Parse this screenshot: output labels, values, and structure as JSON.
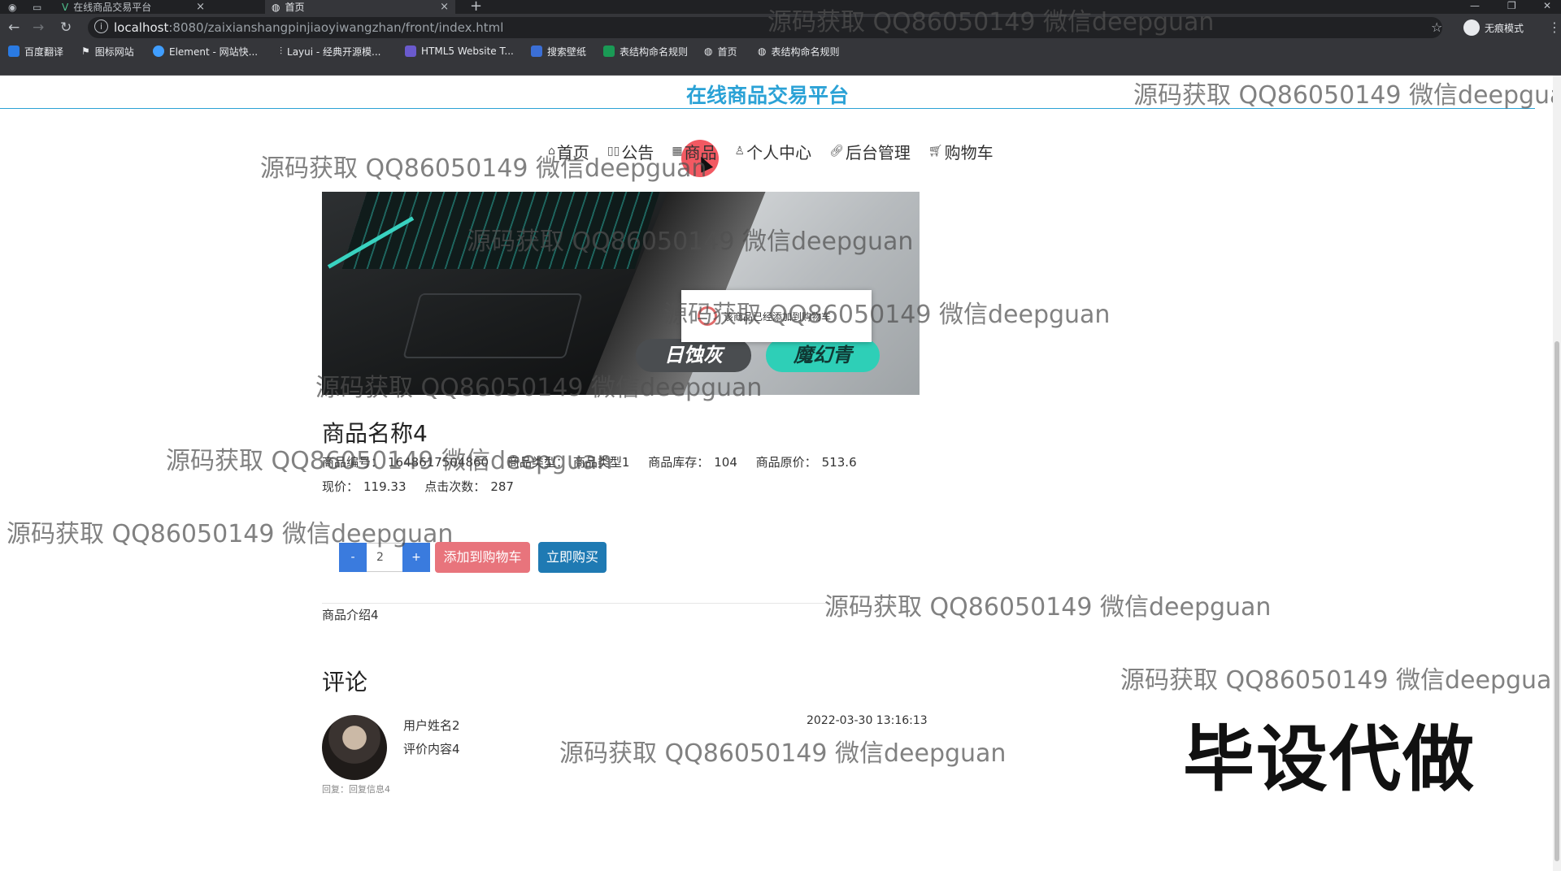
{
  "browser": {
    "tabs": [
      {
        "title": "在线商品交易平台",
        "active": false
      },
      {
        "title": "首页",
        "active": true
      }
    ],
    "new_tab": "+",
    "url_host": "localhost",
    "url_path": ":8080/zaixianshangpinjiaoyiwangzhan/front/index.html",
    "incognito_label": "无痕模式",
    "bookmarks": [
      "百度翻译",
      "图标网站",
      "Element - 网站快...",
      "Layui - 经典开源模...",
      "HTML5 Website T...",
      "搜索壁纸",
      "表结构命名规则",
      "首页",
      "表结构命名规则"
    ]
  },
  "site": {
    "title": "在线商品交易平台",
    "nav": [
      {
        "label": "首页",
        "icon": "home-icon"
      },
      {
        "label": "公告",
        "icon": "announcement-icon"
      },
      {
        "label": "商品",
        "icon": "goods-icon"
      },
      {
        "label": "个人中心",
        "icon": "user-icon"
      },
      {
        "label": "后台管理",
        "icon": "link-icon"
      },
      {
        "label": "购物车",
        "icon": "cart-icon"
      }
    ]
  },
  "product": {
    "image_badges": [
      "日蚀灰",
      "魔幻青"
    ],
    "toast": "该商品已经添加到购物车",
    "name": "商品名称4",
    "code_label": "商品编号：",
    "code": "1648617504860",
    "type_label": "商品类型：",
    "type": "商品类型1",
    "stock_label": "商品库存：",
    "stock": "104",
    "old_price_label": "商品原价：",
    "old_price": "513.6",
    "price_label": "现价：",
    "price": "119.33",
    "clicks_label": "点击次数：",
    "clicks": "287",
    "quantity": "2",
    "minus": "-",
    "plus": "+",
    "add_to_cart": "添加到购物车",
    "buy_now": "立即购买",
    "intro": "商品介绍4"
  },
  "comments": {
    "title": "评论",
    "items": [
      {
        "user": "用户姓名2",
        "content": "评价内容4",
        "time": "2022-03-30 13:16:13",
        "reply": "回复：回复信息4"
      }
    ]
  },
  "overlays": {
    "watermark": "源码获取 QQ86050149 微信deepguan",
    "promo": "毕设代做"
  },
  "colors": {
    "accent": "#2ba2d6",
    "cart_button": "#e8747c",
    "buy_button": "#1f7ab3",
    "stepper": "#3a7bde"
  }
}
